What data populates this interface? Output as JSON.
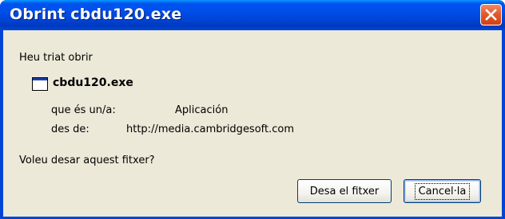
{
  "window": {
    "title": "Obrint cbdu120.exe"
  },
  "dialog": {
    "intro": "Heu triat obrir",
    "file_name": "cbdu120.exe",
    "type_label": "que és un/a:",
    "type_value": "Aplicación",
    "from_label": "des de:",
    "from_value": "http://media.cambridgesoft.com",
    "question": "Voleu desar aquest fitxer?"
  },
  "buttons": {
    "save_label": "Desa el fitxer",
    "cancel_label": "Cancel·la"
  },
  "icons": {
    "close": "close-icon",
    "file": "application-window-icon"
  },
  "colors": {
    "titlebar": "#0053ee",
    "close_button": "#e35a2c",
    "dialog_background": "#ece9d8",
    "button_border": "#003c74"
  }
}
